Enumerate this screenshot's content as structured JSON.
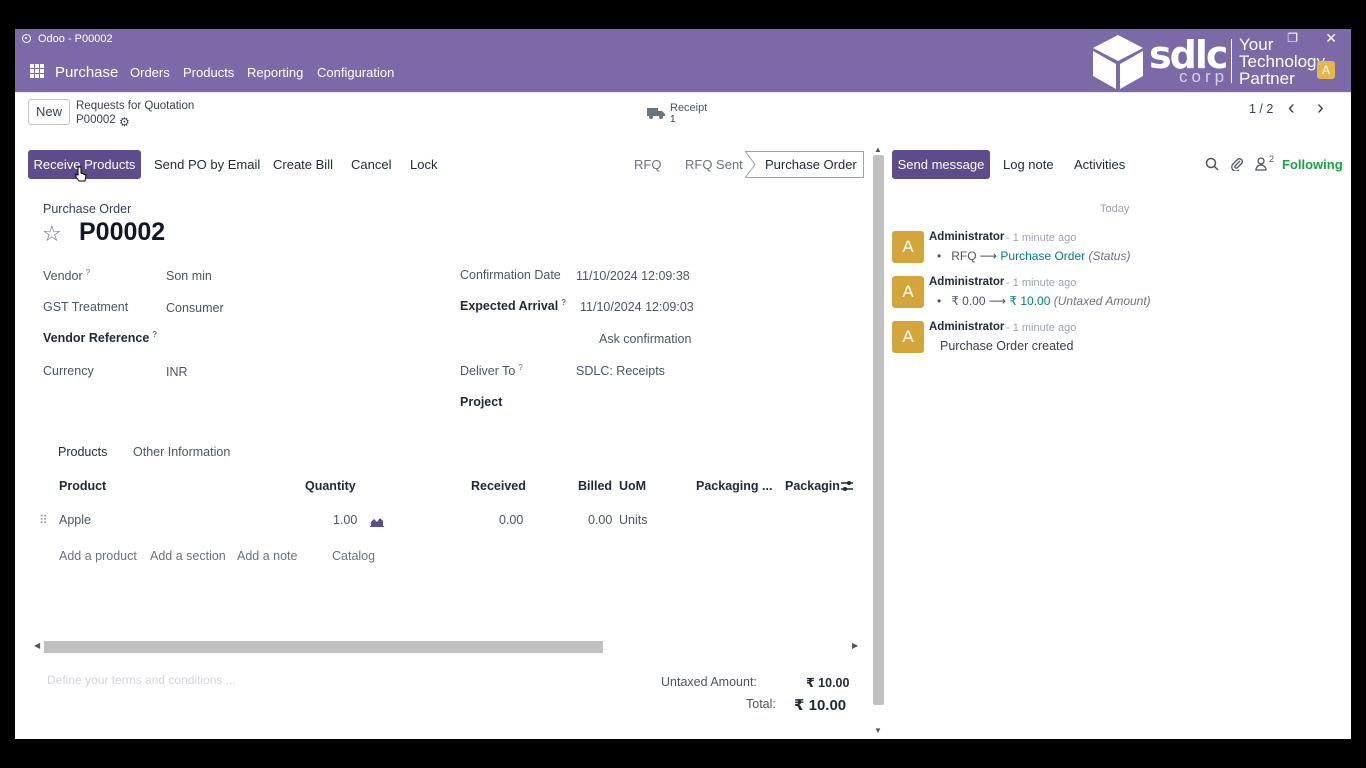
{
  "window": {
    "title": "Odoo - P00002"
  },
  "navbar": {
    "app_name": "Purchase",
    "menu": [
      "Orders",
      "Products",
      "Reporting",
      "Configuration"
    ],
    "logo_text": "sdlc",
    "logo_sub": "corp",
    "logo_tag": [
      "Your",
      "Technology",
      "Partner"
    ],
    "avatar": "A"
  },
  "control": {
    "new_label": "New",
    "breadcrumb": "Requests for Quotation",
    "record": "P00002",
    "receipt_label": "Receipt",
    "receipt_count": "1",
    "pager": "1 / 2"
  },
  "actions": {
    "receive": "Receive Products",
    "send_po": "Send PO by Email",
    "create_bill": "Create Bill",
    "cancel": "Cancel",
    "lock": "Lock"
  },
  "status": {
    "rfq": "RFQ",
    "rfq_sent": "RFQ Sent",
    "current": "Purchase Order"
  },
  "form": {
    "subtitle": "Purchase Order",
    "title": "P00002",
    "vendor_label": "Vendor",
    "vendor": "Son min",
    "gst_label": "GST Treatment",
    "gst": "Consumer",
    "vendor_ref_label": "Vendor Reference",
    "currency_label": "Currency",
    "currency": "INR",
    "conf_date_label": "Confirmation Date",
    "conf_date": "11/10/2024 12:09:38",
    "expected_label": "Expected Arrival",
    "expected": "11/10/2024 12:09:03",
    "ask_confirmation": "Ask confirmation",
    "deliver_label": "Deliver To",
    "deliver": "SDLC: Receipts",
    "project_label": "Project",
    "help_mark": "?"
  },
  "tabs": [
    "Products",
    "Other Information"
  ],
  "lines": {
    "headers": [
      "Product",
      "Quantity",
      "Received",
      "Billed",
      "UoM",
      "Packaging ...",
      "Packagin"
    ],
    "rows": [
      {
        "product": "Apple",
        "quantity": "1.00",
        "received": "0.00",
        "billed": "0.00",
        "uom": "Units"
      }
    ],
    "add_product": "Add a product",
    "add_section": "Add a section",
    "add_note": "Add a note",
    "catalog": "Catalog"
  },
  "totals": {
    "terms_placeholder": "Define your terms and conditions ...",
    "untaxed_label": "Untaxed Amount:",
    "untaxed": "₹ 10.00",
    "total_label": "Total:",
    "total": "₹ 10.00"
  },
  "chatter": {
    "send_message": "Send message",
    "log_note": "Log note",
    "activities": "Activities",
    "followers_count": "2",
    "following": "Following",
    "date_sep": "Today",
    "messages": [
      {
        "avatar": "A",
        "author": "Administrator",
        "ago": "- 1 minute ago",
        "from": "RFQ",
        "to": "Purchase Order",
        "field": "(Status)"
      },
      {
        "avatar": "A",
        "author": "Administrator",
        "ago": "- 1 minute ago",
        "from": "₹ 0.00",
        "to": "₹ 10.00",
        "field": "(Untaxed Amount)"
      },
      {
        "avatar": "A",
        "author": "Administrator",
        "ago": "- 1 minute ago",
        "body": "Purchase Order created"
      }
    ]
  },
  "colors": {
    "brand": "#7c6aa8",
    "primary_button": "#5e4b8b",
    "following": "#16a34a",
    "link": "#017e84",
    "avatar": "#d4a53b"
  }
}
